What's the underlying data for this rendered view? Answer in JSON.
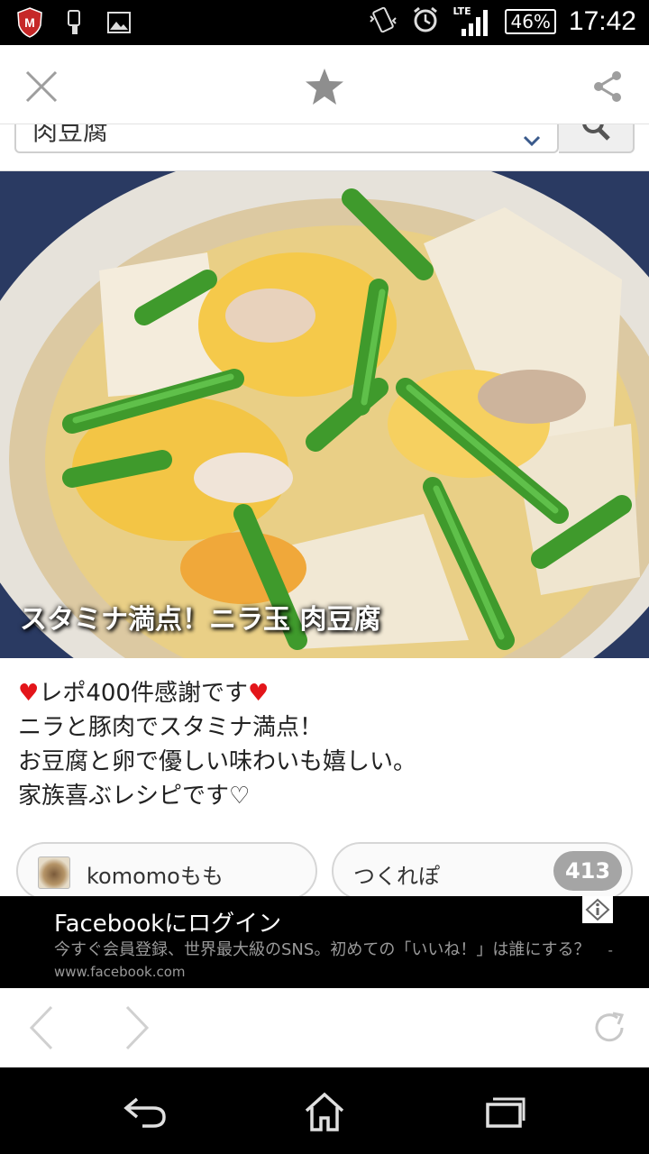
{
  "status_bar": {
    "network": "LTE",
    "battery": "46%",
    "time": "17:42"
  },
  "search": {
    "query": "肉豆腐"
  },
  "recipe": {
    "title": "スタミナ満点！ニラ玉 肉豆腐",
    "description_lines": [
      "♥レポ400件感謝です♥",
      "ニラと豚肉でスタミナ満点！",
      "お豆腐と卵で優しい味わいも嬉しい。",
      "家族喜ぶレシピです♡"
    ],
    "author": "komomoもも",
    "tsukurepo_label": "つくれぽ",
    "tsukurepo_count": "413"
  },
  "ad": {
    "title": "Facebookにログイン",
    "body": "今すぐ会員登録、世界最大級のSNS。初めての「いいね！」は誰にする？",
    "url": "- www.facebook.com"
  }
}
